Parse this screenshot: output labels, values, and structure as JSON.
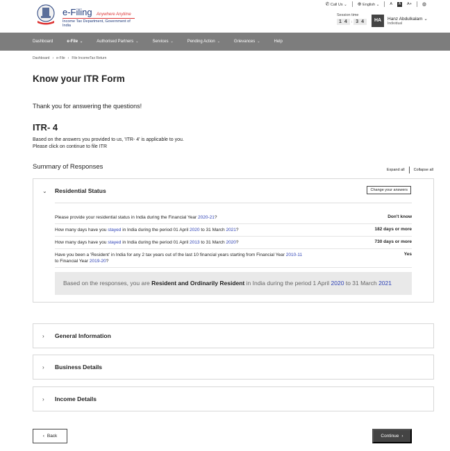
{
  "brand": {
    "title": "e-Filing",
    "tagline": "Anywhere Anytime",
    "subtitle": "Income Tax Department, Government of India"
  },
  "topbar": {
    "call_us": "Call Us",
    "language": "English",
    "font_decrease": "A",
    "font_reset": "A",
    "font_increase": "A+"
  },
  "session": {
    "label": "Session time",
    "minutes": "1 4",
    "seconds": "3 4"
  },
  "user": {
    "initials": "HA",
    "name": "Hanz Abdulkalam",
    "role": "Individual"
  },
  "nav": [
    {
      "label": "Dashboard"
    },
    {
      "label": "e-File"
    },
    {
      "label": "Authorised Partners"
    },
    {
      "label": "Services"
    },
    {
      "label": "Pending Action"
    },
    {
      "label": "Grievances"
    },
    {
      "label": "Help"
    }
  ],
  "breadcrumb": [
    "Dashboard",
    "e-File",
    "File IncomeTax Return"
  ],
  "page": {
    "title": "Know your ITR Form",
    "thanks": "Thank you for answering the questions!",
    "itr_title": "ITR- 4",
    "itr_desc_1": "Based on the answers you provided to us, 'ITR- 4' is applicable to you.",
    "itr_desc_2": "Please click on continue to file ITR",
    "summary_title": "Summary of Responses",
    "expand_all": "Expand all",
    "collapse_all": "Collapse all"
  },
  "residential": {
    "title": "Residential Status",
    "change_button": "Change your answers",
    "questions": [
      {
        "parts": [
          "Please provide your residential status in India during the Financial Year ",
          "2020-21",
          "?"
        ],
        "answer": "Don't know"
      },
      {
        "parts": [
          "How many days have you ",
          "stayed",
          " in India during the period 01 April ",
          "2020",
          " to 31 March ",
          "2021",
          "?"
        ],
        "answer": "182 days or more"
      },
      {
        "parts": [
          "How many days have you ",
          "stayed",
          " in India during the period 01 April ",
          "2013",
          " to 31 March ",
          "2020",
          "?"
        ],
        "answer": "730 days or more"
      },
      {
        "parts": [
          "Have you been a 'Resident' in India for any 2 tax years out of the last 10 financial years starting from Financial Year ",
          "2010-11",
          " to Financial Year ",
          "2019-20",
          "?"
        ],
        "answer": "Yes"
      }
    ],
    "result": {
      "prefix": "Based on the responses, you are ",
      "status": "Resident and Ordinarily Resident",
      "middle": " in India during the period 1 April ",
      "year1": "2020",
      "to": " to 31 March ",
      "year2": "2021"
    }
  },
  "sections": [
    {
      "title": "General Information"
    },
    {
      "title": "Business Details"
    },
    {
      "title": "Income Details"
    }
  ],
  "buttons": {
    "back": "Back",
    "continue": "Continue"
  }
}
